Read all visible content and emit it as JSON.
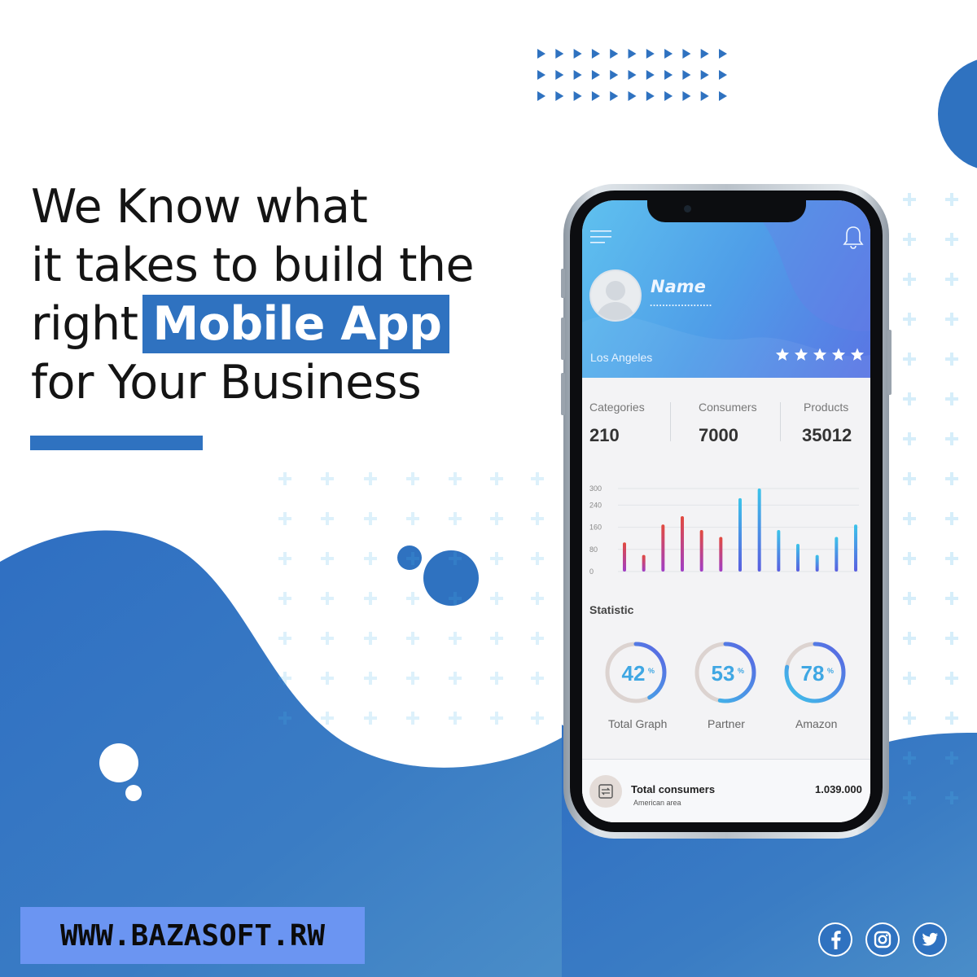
{
  "headline": {
    "line1": "We Know what",
    "line2": "it takes to build the",
    "line3_prefix": "right",
    "line3_highlight": "Mobile App",
    "line4": "for Your Business"
  },
  "website": "WWW.BAZASOFT.RW",
  "colors": {
    "brand_blue": "#2f72c0",
    "website_bg": "#6b95f2",
    "wave_blue": "#3573c0"
  },
  "social": [
    "facebook-icon",
    "instagram-icon",
    "twitter-icon"
  ],
  "app": {
    "profile": {
      "name": "Name",
      "dots": "....................",
      "location": "Los Angeles",
      "rating_stars": 5
    },
    "stats": [
      {
        "label": "Categories",
        "value": "210"
      },
      {
        "label": "Consumers",
        "value": "7000"
      },
      {
        "label": "Products",
        "value": "35012"
      }
    ],
    "statistic_title": "Statistic",
    "rings": [
      {
        "value": "42",
        "unit": "%",
        "label": "Total Graph",
        "fraction": 0.42
      },
      {
        "value": "53",
        "unit": "%",
        "label": "Partner",
        "fraction": 0.53
      },
      {
        "value": "78",
        "unit": "%",
        "label": "Amazon",
        "fraction": 0.78
      }
    ],
    "total": {
      "title": "Total consumers",
      "subtitle": "American area",
      "amount": "1.039.000"
    }
  },
  "chart_data": {
    "type": "bar",
    "yticks": [
      "300",
      "240",
      "160",
      "80",
      "0"
    ],
    "ylim": [
      0,
      300
    ],
    "values": [
      105,
      60,
      170,
      200,
      150,
      125,
      265,
      300,
      150,
      100,
      60,
      125,
      170
    ],
    "colors": [
      "warm",
      "warm",
      "warm",
      "warm",
      "warm",
      "warm",
      "cool",
      "cool",
      "cool",
      "cool",
      "cool",
      "cool",
      "cool"
    ]
  }
}
